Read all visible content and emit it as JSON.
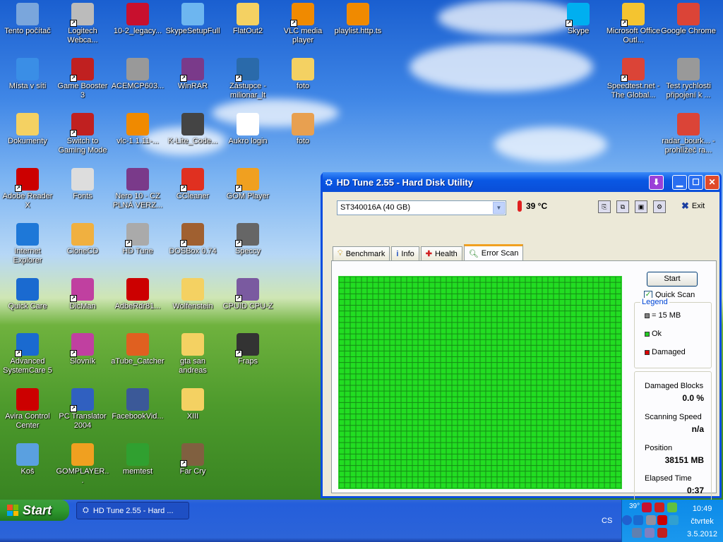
{
  "desktop_icons": [
    {
      "label": "Tento počítač",
      "color": "#7aa6dc",
      "glyph": "computer-icon",
      "sc": false
    },
    {
      "label": "Logitech Webca...",
      "color": "#bbbbbb",
      "glyph": "webcam-icon",
      "sc": true
    },
    {
      "label": "10-2_legacy...",
      "color": "#c8102e",
      "glyph": "ati-icon",
      "sc": false
    },
    {
      "label": "SkypeSetupFull",
      "color": "#6db6f0",
      "glyph": "installer-icon",
      "sc": false
    },
    {
      "label": "FlatOut2",
      "color": "#f4d162",
      "glyph": "folder-icon",
      "sc": false
    },
    {
      "label": "VLC media player",
      "color": "#f08a00",
      "glyph": "vlc-icon",
      "sc": true
    },
    {
      "label": "playlist.http.ts",
      "color": "#f08a00",
      "glyph": "vlc-icon",
      "sc": false
    },
    {
      "label": "Skype",
      "color": "#00aff0",
      "glyph": "skype-icon",
      "sc": true
    },
    {
      "label": "Microsoft Office Outl...",
      "color": "#f4c430",
      "glyph": "outlook-icon",
      "sc": true
    },
    {
      "label": "Google Chrome",
      "color": "#db4437",
      "glyph": "chrome-icon",
      "sc": false
    },
    {
      "label": "Místa v síti",
      "color": "#3a8ee6",
      "glyph": "network-icon",
      "sc": false
    },
    {
      "label": "Game Booster 3",
      "color": "#c02020",
      "glyph": "gamebooster-icon",
      "sc": true
    },
    {
      "label": "ACEMCP603...",
      "color": "#999999",
      "glyph": "program-icon",
      "sc": false
    },
    {
      "label": "WinRAR",
      "color": "#7a3a8a",
      "glyph": "winrar-icon",
      "sc": true
    },
    {
      "label": "Zástupce - milionar_lt",
      "color": "#2a6aaa",
      "glyph": "shortcut-icon",
      "sc": true
    },
    {
      "label": "foto",
      "color": "#f4d162",
      "glyph": "folder-icon",
      "sc": false
    },
    {
      "label": "Speedtest.net - The Global...",
      "color": "#db4437",
      "glyph": "chrome-icon",
      "sc": true
    },
    {
      "label": "Test rychlosti připojení k ...",
      "color": "#999999",
      "glyph": "webpage-icon",
      "sc": false
    },
    {
      "label": "Dokumenty",
      "color": "#f4d162",
      "glyph": "documents-icon",
      "sc": false
    },
    {
      "label": "Switch to Gaming Mode",
      "color": "#c02020",
      "glyph": "gamebooster-icon",
      "sc": true
    },
    {
      "label": "vlc-1.1.11-...",
      "color": "#f08a00",
      "glyph": "vlc-icon",
      "sc": false
    },
    {
      "label": "K-Lite_Code...",
      "color": "#444444",
      "glyph": "klite-icon",
      "sc": false
    },
    {
      "label": "Aukro login",
      "color": "#ffffff",
      "glyph": "document-icon",
      "sc": false
    },
    {
      "label": "foto",
      "color": "#e8a050",
      "glyph": "image-icon",
      "sc": false
    },
    {
      "label": "radar_bourk... - prohlížeč ra...",
      "color": "#db4437",
      "glyph": "chrome-icon",
      "sc": false
    },
    {
      "label": "Adobe Reader X",
      "color": "#cc0000",
      "glyph": "pdf-icon",
      "sc": true
    },
    {
      "label": "Fonts",
      "color": "#dddddd",
      "glyph": "fonts-icon",
      "sc": false
    },
    {
      "label": "Nero 10 - CZ PLNÁ VERZ...",
      "color": "#7a3a8a",
      "glyph": "winrar-icon",
      "sc": false
    },
    {
      "label": "CCleaner",
      "color": "#e03020",
      "glyph": "ccleaner-icon",
      "sc": true
    },
    {
      "label": "GOM Player",
      "color": "#f0a020",
      "glyph": "gom-icon",
      "sc": true
    },
    {
      "label": "Internet Explorer",
      "color": "#1e78d8",
      "glyph": "ie-icon",
      "sc": false
    },
    {
      "label": "CloneCD",
      "color": "#f0b040",
      "glyph": "clonecd-icon",
      "sc": false
    },
    {
      "label": "HD Tune",
      "color": "#aaaaaa",
      "glyph": "hdtune-icon",
      "sc": true
    },
    {
      "label": "DOSBox 0.74",
      "color": "#a06030",
      "glyph": "dosbox-icon",
      "sc": true
    },
    {
      "label": "Speccy",
      "color": "#666666",
      "glyph": "speccy-icon",
      "sc": true
    },
    {
      "label": "Quick Care",
      "color": "#1a6ad0",
      "glyph": "quickcare-icon",
      "sc": false
    },
    {
      "label": "DicMan",
      "color": "#c040a0",
      "glyph": "dicman-icon",
      "sc": true
    },
    {
      "label": "AdbeRdr81...",
      "color": "#cc0000",
      "glyph": "pdf-icon",
      "sc": false
    },
    {
      "label": "Wolfenstein",
      "color": "#f4d162",
      "glyph": "folder-icon",
      "sc": false
    },
    {
      "label": "CPUID CPU-Z",
      "color": "#7a5aa0",
      "glyph": "cpuz-icon",
      "sc": true
    },
    {
      "label": "Advanced SystemCare 5",
      "color": "#1a6ad0",
      "glyph": "quickcare-icon",
      "sc": true
    },
    {
      "label": "Slovník",
      "color": "#c040a0",
      "glyph": "dicman-icon",
      "sc": true
    },
    {
      "label": "aTube_Catcher",
      "color": "#e06020",
      "glyph": "atube-icon",
      "sc": false
    },
    {
      "label": "gta san andreas",
      "color": "#f4d162",
      "glyph": "folder-icon",
      "sc": false
    },
    {
      "label": "Fraps",
      "color": "#333333",
      "glyph": "fraps-icon",
      "sc": true
    },
    {
      "label": "Avira Control Center",
      "color": "#cc0000",
      "glyph": "avira-icon",
      "sc": false
    },
    {
      "label": "PC Translator 2004",
      "color": "#3060c0",
      "glyph": "translator-icon",
      "sc": true
    },
    {
      "label": "FacebookVid...",
      "color": "#3b5998",
      "glyph": "facebook-icon",
      "sc": false
    },
    {
      "label": "XIII",
      "color": "#f4d162",
      "glyph": "folder-icon",
      "sc": false
    },
    {
      "label": "Koš",
      "color": "#5aa0e0",
      "glyph": "recycle-bin-icon",
      "sc": false
    },
    {
      "label": "GOMPLAYER...",
      "color": "#f0a020",
      "glyph": "gom-icon",
      "sc": false
    },
    {
      "label": "memtest",
      "color": "#30a030",
      "glyph": "memtest-icon",
      "sc": false
    },
    {
      "label": "Far Cry",
      "color": "#806040",
      "glyph": "farcry-icon",
      "sc": true
    }
  ],
  "window": {
    "title": "HD Tune 2.55 - Hard Disk Utility",
    "disk": "ST340016A (40 GB)",
    "temperature": "39 °C",
    "exit_label": "Exit",
    "tabs": [
      {
        "label": "Benchmark",
        "active": false
      },
      {
        "label": "Info",
        "active": false
      },
      {
        "label": "Health",
        "active": false
      },
      {
        "label": "Error Scan",
        "active": true
      }
    ],
    "start_label": "Start",
    "quick_scan_label": "Quick Scan",
    "quick_scan_checked": true,
    "legend_title": "Legend",
    "legend": [
      {
        "label": "= 15 MB",
        "color": "#808080"
      },
      {
        "label": "Ok",
        "color": "#22cc22"
      },
      {
        "label": "Damaged",
        "color": "#dd0000"
      }
    ],
    "stats": [
      {
        "label": "Damaged Blocks",
        "value": "0.0 %"
      },
      {
        "label": "Scanning Speed",
        "value": "n/a"
      },
      {
        "label": "Position",
        "value": "38151 MB"
      },
      {
        "label": "Elapsed Time",
        "value": "0:37"
      }
    ],
    "grid_colors": {
      "ok": "#22dd22",
      "line": "#158c15"
    }
  },
  "taskbar": {
    "start_label": "Start",
    "task_label": "HD Tune 2.55 - Hard ...",
    "language": "CS",
    "tray_temp": "39°",
    "clock_time": "10:49",
    "clock_day": "čtvrtek",
    "clock_date": "3.5.2012"
  }
}
